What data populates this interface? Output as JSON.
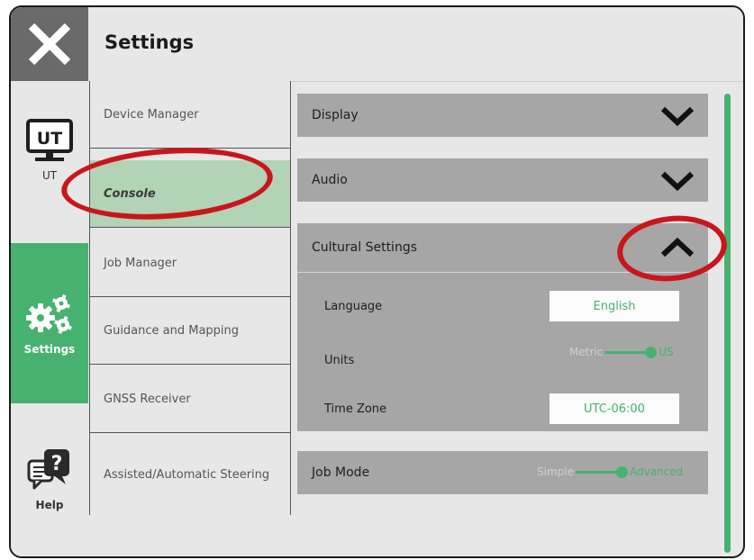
{
  "header": {
    "title": "Settings",
    "close_icon": "close-icon"
  },
  "nav": [
    {
      "label": "UT",
      "icon": "ut-monitor-icon"
    },
    {
      "label": "Settings",
      "icon": "gears-icon"
    },
    {
      "label": "Help",
      "icon": "help-icon"
    }
  ],
  "menu": [
    {
      "label": "Device Manager"
    },
    {
      "label": "Console"
    },
    {
      "label": "Job Manager"
    },
    {
      "label": "Guidance and Mapping"
    },
    {
      "label": "GNSS Receiver"
    },
    {
      "label": "Assisted/Automatic Steering"
    }
  ],
  "panels": {
    "display": {
      "label": "Display"
    },
    "audio": {
      "label": "Audio"
    },
    "cultural": {
      "label": "Cultural Settings",
      "language_label": "Language",
      "language_value": "English",
      "units_label": "Units",
      "units_off": "Metric",
      "units_on": "US",
      "units_selected": "US",
      "timezone_label": "Time Zone",
      "timezone_value": "UTC-06:00"
    },
    "job_mode": {
      "label": "Job Mode",
      "off": "Simple",
      "on": "Advanced",
      "selected": "Advanced"
    }
  },
  "colors": {
    "accent": "#47b26f",
    "highlight": "#c8161d",
    "panel": "#a6a6a6"
  }
}
